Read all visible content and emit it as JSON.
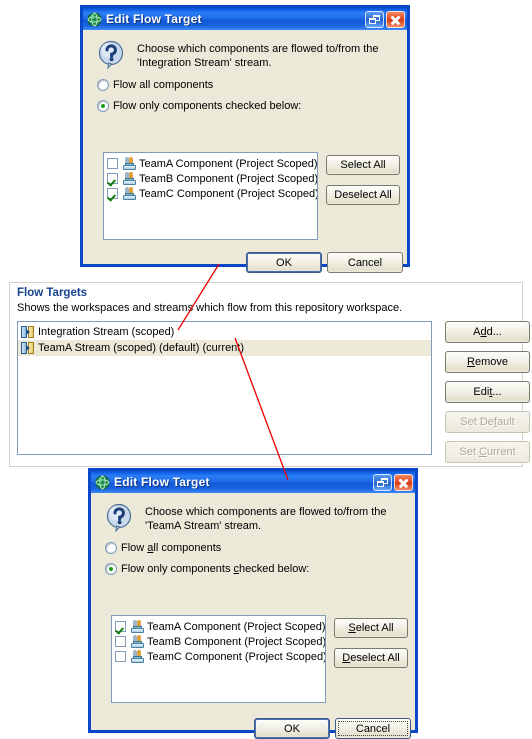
{
  "dialog_top": {
    "title": "Edit Flow Target",
    "title_icon": "globe-icon",
    "restore_button_icon": "restore-window-icon",
    "close_button_icon": "close-window-icon",
    "prompt_icon": "question-icon",
    "prompt_line1": "Choose which components are flowed to/from the",
    "prompt_line2": "'Integration Stream' stream.",
    "radio_all_label": "Flow all components",
    "radio_checked_label": "Flow only components checked below:",
    "radio_selected": "checked_below",
    "components": [
      {
        "label": "TeamA Component (Project Scoped)",
        "checked": false
      },
      {
        "label": "TeamB Component (Project Scoped)",
        "checked": true
      },
      {
        "label": "TeamC Component (Project Scoped)",
        "checked": true
      }
    ],
    "select_all_label": "Select All",
    "deselect_all_label": "Deselect All",
    "ok_label": "OK",
    "cancel_label": "Cancel"
  },
  "flow_targets": {
    "section_title": "Flow Targets",
    "section_desc": "Shows the workspaces and streams which flow from this repository workspace.",
    "rows": [
      {
        "label": "Integration Stream (scoped)",
        "selected": false
      },
      {
        "label": "TeamA Stream (scoped) (default) (current)",
        "selected": true
      }
    ],
    "buttons": [
      {
        "label": "Add...",
        "mnemonic": "d",
        "enabled": true
      },
      {
        "label": "Remove",
        "mnemonic": "R",
        "enabled": true
      },
      {
        "label": "Edit...",
        "mnemonic": "t",
        "enabled": true
      },
      {
        "label": "Set Default",
        "mnemonic": "f",
        "enabled": false
      },
      {
        "label": "Set Current",
        "mnemonic": "C",
        "enabled": false
      }
    ]
  },
  "dialog_bottom": {
    "title": "Edit Flow Target",
    "title_icon": "globe-icon",
    "restore_button_icon": "restore-window-icon",
    "close_button_icon": "close-window-icon",
    "prompt_icon": "question-icon",
    "prompt_line1": "Choose which components are flowed to/from the",
    "prompt_line2": "'TeamA Stream' stream.",
    "radio_all_label_pre": "Flow ",
    "radio_all_label_mn": "a",
    "radio_all_label_post": "ll components",
    "radio_checked_label_pre": "Flow only components ",
    "radio_checked_label_mn": "c",
    "radio_checked_label_post": "hecked below:",
    "radio_selected": "checked_below",
    "components": [
      {
        "label": "TeamA Component (Project Scoped)",
        "checked": true
      },
      {
        "label": "TeamB Component (Project Scoped)",
        "checked": false
      },
      {
        "label": "TeamC Component (Project Scoped)",
        "checked": false
      }
    ],
    "select_all_label_mn": "S",
    "select_all_label_rest": "elect All",
    "deselect_all_label_mn": "D",
    "deselect_all_label_rest": "eselect All",
    "ok_label": "OK",
    "cancel_label": "Cancel"
  },
  "colors": {
    "title_bar_blue": "#1160e8",
    "dialog_border": "#0a46c8",
    "dialog_face": "#ece9d8",
    "section_title": "#15428b",
    "annotation_red": "#ee0000",
    "checkbox_check": "#107c10",
    "radio_dot": "#18a018"
  }
}
